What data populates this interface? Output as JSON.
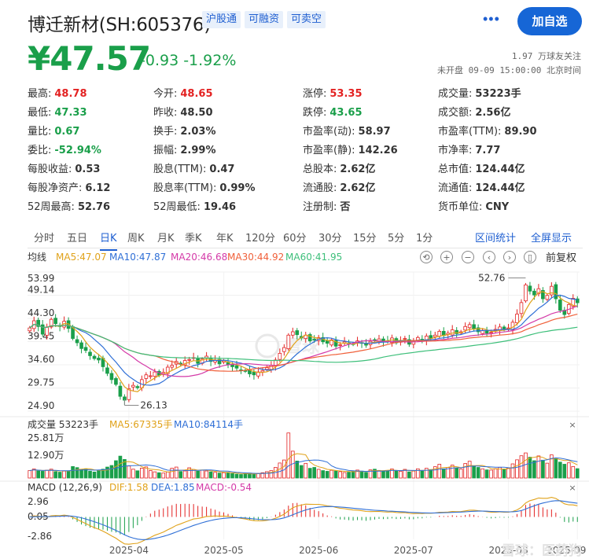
{
  "header": {
    "stock_name": "博迁新材(SH:605376)",
    "tags": [
      "沪股通",
      "可融资",
      "可卖空"
    ],
    "more_icon": "more-dots-icon",
    "add_button": "加自选"
  },
  "quote": {
    "price": "¥47.57",
    "change": "-0.93  -1.92%",
    "followers": "1.97 万球友关注",
    "status": "未开盘 09-09 15:00:00 北京时间"
  },
  "stats": [
    {
      "label": "最高:",
      "value": "48.78",
      "color": "red"
    },
    {
      "label": "今开:",
      "value": "48.65",
      "color": "red"
    },
    {
      "label": "涨停:",
      "value": "53.35",
      "color": "red"
    },
    {
      "label": "成交量:",
      "value": "53223手",
      "color": ""
    },
    {
      "label": "最低:",
      "value": "47.33",
      "color": "grn"
    },
    {
      "label": "昨收:",
      "value": "48.50",
      "color": ""
    },
    {
      "label": "跌停:",
      "value": "43.65",
      "color": "grn"
    },
    {
      "label": "成交额:",
      "value": "2.56亿",
      "color": ""
    },
    {
      "label": "量比:",
      "value": "0.67",
      "color": "grn"
    },
    {
      "label": "换手:",
      "value": "2.03%",
      "color": ""
    },
    {
      "label": "市盈率(动):",
      "value": "58.97",
      "color": ""
    },
    {
      "label": "市盈率(TTM):",
      "value": "89.90",
      "color": ""
    },
    {
      "label": "委比:",
      "value": "-52.94%",
      "color": "grn"
    },
    {
      "label": "振幅:",
      "value": "2.99%",
      "color": ""
    },
    {
      "label": "市盈率(静):",
      "value": "142.26",
      "color": ""
    },
    {
      "label": "市净率:",
      "value": "7.77",
      "color": ""
    },
    {
      "label": "每股收益:",
      "value": "0.53",
      "color": ""
    },
    {
      "label": "股息(TTM):",
      "value": "0.47",
      "color": ""
    },
    {
      "label": "总股本:",
      "value": "2.62亿",
      "color": ""
    },
    {
      "label": "总市值:",
      "value": "124.44亿",
      "color": ""
    },
    {
      "label": "每股净资产:",
      "value": "6.12",
      "color": ""
    },
    {
      "label": "股息率(TTM):",
      "value": "0.99%",
      "color": ""
    },
    {
      "label": "流通股:",
      "value": "2.62亿",
      "color": ""
    },
    {
      "label": "流通值:",
      "value": "124.44亿",
      "color": ""
    },
    {
      "label": "52周最高:",
      "value": "52.76",
      "color": ""
    },
    {
      "label": "52周最低:",
      "value": "19.46",
      "color": ""
    },
    {
      "label": "注册制:",
      "value": "否",
      "color": ""
    },
    {
      "label": "货币单位:",
      "value": "CNY",
      "color": ""
    }
  ],
  "tabs": [
    "分时",
    "五日",
    "日K",
    "周K",
    "月K",
    "季K",
    "年K",
    "120分",
    "60分",
    "30分",
    "15分",
    "5分",
    "1分"
  ],
  "active_tab": "日K",
  "tab_links": [
    "区间统计",
    "全屏显示"
  ],
  "chart_toolbar": {
    "title": "均线",
    "ma_labels": [
      {
        "text": "MA5:47.07",
        "color": "#e0a21a"
      },
      {
        "text": "MA10:47.87",
        "color": "#2f6fd6"
      },
      {
        "text": "MA20:46.68",
        "color": "#d43aa8"
      },
      {
        "text": "MA30:44.92",
        "color": "#f0603a"
      },
      {
        "text": "MA60:41.95",
        "color": "#3dbf7a"
      }
    ],
    "icons": [
      "undo-icon",
      "zoom-in-icon",
      "zoom-out-icon",
      "scroll-left-icon",
      "scroll-right-icon",
      "pause-icon"
    ],
    "adjust_label": "前复权"
  },
  "volume_header": {
    "title": "成交量 53223手",
    "ma5": "MA5:67335手",
    "ma10": "MA10:84114手"
  },
  "macd_header": {
    "title": "MACD (12,26,9)",
    "dif": "DIF:1.58",
    "dea": "DEA:1.85",
    "macd": "MACD:-0.54"
  },
  "watermark": "雪球",
  "footer_watermark": "雪球：医药狗",
  "colors": {
    "up": "#e32222",
    "down": "#1a9f4a",
    "accent": "#1f5fd1"
  },
  "chart_data": {
    "type": "candlestick",
    "price_axis": {
      "ticks": [
        "53.99",
        "49.14",
        "44.30",
        "39.45",
        "34.60",
        "29.75",
        "24.90"
      ],
      "ylim": [
        24.9,
        53.99
      ]
    },
    "max_label": "52.76",
    "min_label": "26.13",
    "volume_axis": {
      "ticks": [
        "25.81万",
        "12.90万"
      ]
    },
    "macd_axis": {
      "ticks": [
        "2.96",
        "0.05",
        "-2.86"
      ]
    },
    "x_labels": [
      "2025-04",
      "2025-05",
      "2025-06",
      "2025-07",
      "2025-08",
      "2025-09"
    ],
    "closes": [
      42.3,
      43.8,
      42.6,
      41.0,
      42.5,
      44.1,
      43.2,
      42.6,
      43.7,
      42.2,
      40.1,
      39.2,
      38.0,
      37.6,
      36.5,
      35.9,
      35.6,
      34.2,
      32.8,
      31.5,
      30.5,
      28.0,
      27.2,
      29.6,
      30.3,
      29.8,
      31.5,
      32.5,
      32.3,
      33.1,
      32.4,
      33.0,
      34.1,
      34.5,
      35.3,
      34.7,
      35.5,
      35.7,
      36.1,
      34.9,
      35.8,
      36.4,
      35.3,
      35.6,
      34.8,
      35.4,
      34.6,
      34.2,
      33.9,
      33.5,
      33.3,
      32.7,
      32.5,
      33.1,
      33.4,
      34.0,
      34.5,
      35.6,
      37.0,
      38.2,
      40.8,
      41.5,
      40.9,
      40.2,
      40.8,
      39.6,
      39.9,
      40.3,
      39.4,
      39.1,
      39.8,
      38.5,
      38.8,
      39.4,
      39.0,
      38.9,
      39.6,
      39.1,
      38.7,
      39.5,
      39.8,
      40.0,
      39.4,
      39.6,
      40.2,
      39.2,
      39.7,
      40.1,
      38.9,
      39.5,
      40.3,
      39.8,
      40.6,
      40.1,
      40.8,
      41.6,
      40.7,
      41.2,
      41.9,
      41.1,
      41.5,
      42.6,
      43.0,
      42.1,
      41.5,
      41.8,
      41.2,
      41.4,
      42.0,
      42.5,
      42.0,
      42.3,
      43.5,
      45.2,
      47.6,
      51.3,
      50.0,
      49.2,
      50.5,
      48.4,
      49.1,
      51.0,
      48.4,
      46.0,
      45.1,
      47.2,
      48.5,
      47.57
    ],
    "volumes": [
      4.2,
      5.1,
      4.0,
      3.8,
      4.4,
      5.0,
      3.6,
      3.3,
      3.9,
      4.1,
      6.5,
      5.9,
      4.8,
      5.2,
      3.9,
      3.4,
      4.2,
      5.0,
      6.2,
      7.1,
      9.8,
      12.4,
      10.5,
      6.8,
      5.0,
      4.1,
      5.6,
      6.3,
      4.2,
      3.5,
      3.0,
      2.8,
      3.4,
      5.5,
      6.2,
      3.7,
      4.0,
      5.8,
      4.8,
      3.9,
      4.4,
      4.0,
      3.5,
      3.2,
      2.8,
      3.0,
      3.2,
      2.5,
      2.2,
      2.0,
      2.5,
      2.8,
      2.3,
      2.6,
      3.0,
      3.6,
      4.2,
      6.0,
      8.5,
      10.2,
      25.5,
      15.2,
      9.6,
      7.1,
      8.3,
      5.5,
      6.0,
      4.9,
      4.2,
      3.8,
      4.4,
      4.0,
      3.6,
      3.1,
      3.3,
      3.8,
      4.5,
      3.9,
      3.2,
      4.6,
      5.0,
      4.3,
      3.9,
      4.2,
      5.1,
      4.0,
      3.8,
      4.9,
      3.5,
      3.9,
      5.2,
      4.0,
      5.5,
      4.8,
      6.4,
      7.8,
      5.2,
      6.0,
      7.3,
      5.8,
      5.1,
      8.2,
      9.5,
      6.6,
      6.0,
      5.2,
      4.6,
      4.5,
      5.3,
      6.0,
      5.0,
      5.6,
      8.0,
      10.3,
      12.6,
      14.2,
      11.8,
      9.8,
      12.5,
      10.1,
      8.4,
      13.1,
      11.2,
      9.0,
      7.8,
      8.6,
      6.5,
      5.3
    ],
    "ma_series": [
      "MA5",
      "MA10",
      "MA20",
      "MA30",
      "MA60"
    ]
  }
}
